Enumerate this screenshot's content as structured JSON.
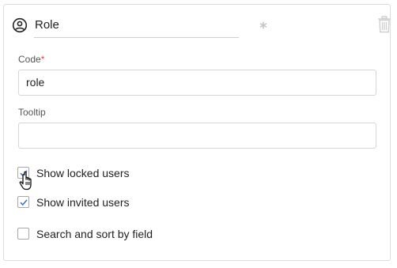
{
  "header": {
    "title_value": "Role",
    "user_icon": "user-circle-icon",
    "drag_icon": "asterisk-drag-icon",
    "trash_icon": "trash-icon"
  },
  "fields": {
    "code": {
      "label": "Code",
      "required_marker": "*",
      "value": "role"
    },
    "tooltip": {
      "label": "Tooltip",
      "value": ""
    }
  },
  "options": [
    {
      "label": "Show locked users",
      "checked": true
    },
    {
      "label": "Show invited users",
      "checked": true
    },
    {
      "label": "Search and sort by field",
      "checked": false
    }
  ],
  "colors": {
    "check_accent": "#3a6fd8",
    "required": "#e0463c"
  }
}
